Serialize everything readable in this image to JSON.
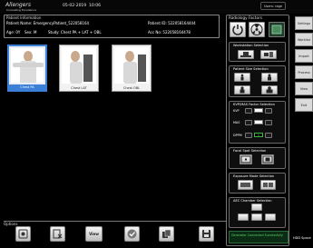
{
  "topbar": {
    "logo": "Allengers",
    "logo_sub": "Innovating Excellence",
    "date": "05-02-2019",
    "time": "10:06",
    "user": "Users: rage"
  },
  "patient_info": {
    "title": "Patient Information",
    "name_label": "Patient Name:",
    "name_value": "EmergencyPatient_522058164",
    "id_label": "Patient ID:",
    "id_value": "522058164444",
    "age_label": "Age:",
    "age_value": "0Y",
    "sex_label": "Sex:",
    "sex_value": "M",
    "study_label": "Study:",
    "study_value": "Chest PA + LAT + OBL",
    "acc_label": "Acc No:",
    "acc_value": "522058164478"
  },
  "thumbnails": [
    {
      "caption": "Chest PA",
      "selected": true
    },
    {
      "caption": "Chest LAT",
      "selected": false
    },
    {
      "caption": "Chest OBL",
      "selected": false
    }
  ],
  "options": {
    "title": "Options",
    "buttons": [
      {
        "icon": "acquire-icon"
      },
      {
        "icon": "delete-image-icon"
      },
      {
        "icon": "view-icon",
        "label": "View"
      },
      {
        "icon": "check-icon"
      },
      {
        "icon": "copy-pages-icon"
      },
      {
        "icon": "save-disk-icon"
      }
    ]
  },
  "radiology": {
    "title": "Radiology Factors",
    "workstation_title": "Workstation Selection",
    "patient_size_title": "Patient Size Selection",
    "kvp_title": "KVP/MAS Factor Selection",
    "kvp_label": "KVP",
    "mas_label": "MAS",
    "dppm_label": "DPPM",
    "dppm_value": "0",
    "focal_title": "Focal Spot Selection",
    "exposure_title": "Exposure Mode Selection",
    "aec_title": "AEC Chamber Selection",
    "status_text": "Generator Connected Successfully"
  },
  "side_tabs": [
    "Settings",
    "Worklist",
    "Import",
    "Process",
    "View",
    "Exit"
  ],
  "hdd": "HDD Space"
}
